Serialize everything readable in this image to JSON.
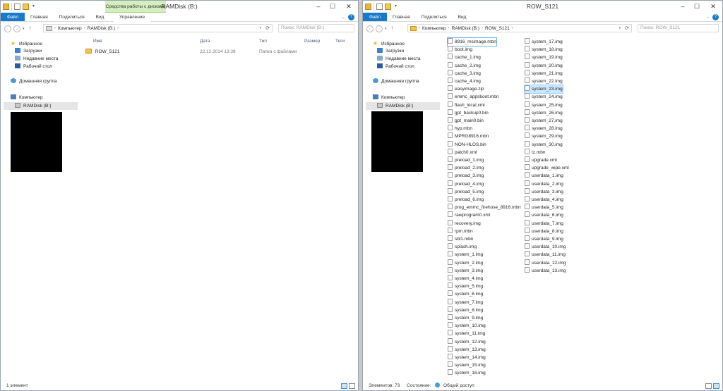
{
  "window1": {
    "title": "RAMDisk (B:)",
    "context_group": "Средства работы с дисками",
    "tabs": [
      "Файл",
      "Главная",
      "Поделиться",
      "Вид",
      "Управление"
    ],
    "breadcrumb": [
      "Компьютер",
      "RAMDisk (B:)"
    ],
    "search_placeholder": "Поиск: RAMDisk (B:)",
    "columns": [
      "Имя",
      "Дата",
      "Тип",
      "Размер",
      "Теги"
    ],
    "rows": [
      {
        "name": "ROW_S121",
        "date": "22.12.2014 13:39",
        "type": "Папка с файлами"
      }
    ],
    "status": "1 элемент"
  },
  "window2": {
    "title": "ROW_S121",
    "tabs": [
      "Файл",
      "Главная",
      "Поделиться",
      "Вид"
    ],
    "breadcrumb": [
      "Компьютер",
      "RAMDisk (B:)",
      "ROW_S121"
    ],
    "search_placeholder": "Поиск: ROW_S121",
    "files_col1": [
      "8916_msimage.mbn",
      "boot.img",
      "cache_1.img",
      "cache_2.img",
      "cache_3.img",
      "cache_4.img",
      "easyimage.zip",
      "emmc_appsboot.mbn",
      "flash_local.xml",
      "gpt_backup0.bin",
      "gpt_main0.bin",
      "hyp.mbn",
      "MPRG8916.mbn",
      "NON-HLOS.bin",
      "patch0.xml",
      "preload_1.img",
      "preload_2.img",
      "preload_3.img",
      "preload_4.img",
      "preload_5.img",
      "preload_6.img",
      "prog_emmc_firehose_8916.mbn",
      "rawprogram0.xml",
      "recovery.img",
      "rpm.mbn",
      "sbl1.mbn",
      "splash.img",
      "system_1.img",
      "system_2.img",
      "system_3.img",
      "system_4.img",
      "system_5.img",
      "system_6.img",
      "system_7.img",
      "system_8.img",
      "system_9.img",
      "system_10.img",
      "system_11.img",
      "system_12.img",
      "system_13.img",
      "system_14.img",
      "system_15.img",
      "system_16.img"
    ],
    "files_col2": [
      "system_17.img",
      "system_18.img",
      "system_19.img",
      "system_20.img",
      "system_21.img",
      "system_22.img",
      "system_23.img",
      "system_24.img",
      "system_25.img",
      "system_26.img",
      "system_27.img",
      "system_28.img",
      "system_29.img",
      "system_30.img",
      "tz.mbn",
      "upgrade.xml",
      "upgrade_wipe.xml",
      "userdata_1.img",
      "userdata_2.img",
      "userdata_3.img",
      "userdata_4.img",
      "userdata_5.img",
      "userdata_6.img",
      "userdata_7.img",
      "userdata_8.img",
      "userdata_9.img",
      "userdata_10.img",
      "userdata_11.img",
      "userdata_12.img",
      "userdata_13.img"
    ],
    "status_count": "Элементов: 73",
    "status_state_label": "Состояние:",
    "status_state_value": "Общий доступ"
  },
  "nav": {
    "favorites": "Избранное",
    "downloads": "Загрузки",
    "recent": "Недавние места",
    "desktop": "Рабочий стол",
    "homegroup": "Домашняя группа",
    "computer": "Компьютер",
    "ramdisk": "RAMDisk (B:)"
  },
  "colors": {
    "file_tab": "#1979ca",
    "context_group": "#d5eebe",
    "selection": "#cce8ff"
  },
  "icons": [
    "folder-icon",
    "file-icon",
    "star-icon",
    "downloads-icon",
    "recent-places-icon",
    "desktop-icon",
    "homegroup-icon",
    "computer-icon",
    "drive-icon",
    "search-icon",
    "close-icon",
    "minimize-icon",
    "maximize-icon"
  ]
}
